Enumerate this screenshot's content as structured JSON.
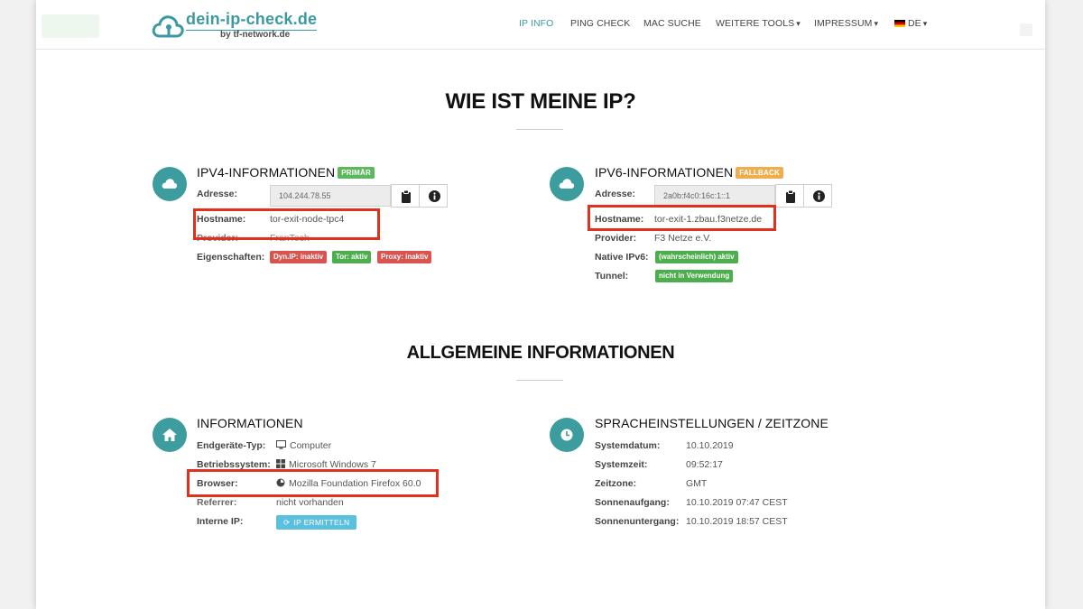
{
  "header": {
    "logo_title": "dein-ip-check.de",
    "logo_sub": "by tf-network.de",
    "nav": [
      {
        "label": "IP INFO",
        "active": true
      },
      {
        "label": "PING CHECK"
      },
      {
        "label": "MAC SUCHE"
      },
      {
        "label": "WEITERE TOOLS"
      },
      {
        "label": "IMPRESSUM"
      },
      {
        "label": "DE"
      }
    ]
  },
  "main_title": "WIE IST MEINE IP?",
  "ipv4": {
    "title": "IPV4-INFORMATIONEN",
    "badge": "PRIMÄR",
    "address_label": "Adresse:",
    "address_value": "104.244.78.55",
    "hostname_label": "Hostname:",
    "hostname_value": "tor-exit-node-tpc4",
    "provider_label": "Provider:",
    "provider_value": "FranTech",
    "props_label": "Eigenschaften:",
    "tags": [
      "Dyn.IP: inaktiv",
      "Tor: aktiv",
      "Proxy: inaktiv"
    ]
  },
  "ipv6": {
    "title": "IPV6-INFORMATIONEN",
    "badge": "FALLBACK",
    "address_label": "Adresse:",
    "address_value": "2a0b:f4c0:16c:1::1",
    "hostname_label": "Hostname:",
    "hostname_value": "tor-exit-1.zbau.f3netze.de",
    "provider_label": "Provider:",
    "provider_value": "F3 Netze e.V.",
    "native_label": "Native IPv6:",
    "native_value": "(wahrscheinlich) aktiv",
    "tunnel_label": "Tunnel:",
    "tunnel_value": "nicht in Verwendung"
  },
  "general_title": "ALLGEMEINE INFORMATIONEN",
  "info": {
    "title": "INFORMATIONEN",
    "device_label": "Endgeräte-Typ:",
    "device_value": "Computer",
    "os_label": "Betriebssystem:",
    "os_value": "Microsoft Windows 7",
    "browser_label": "Browser:",
    "browser_value": "Mozilla Foundation Firefox 60.0",
    "referrer_label": "Referrer:",
    "referrer_value": "nicht vorhanden",
    "internal_ip_label": "Interne IP:",
    "internal_ip_button": "IP ERMITTELN"
  },
  "locale": {
    "title": "SPRACHEINSTELLUNGEN / ZEITZONE",
    "date_label": "Systemdatum:",
    "date_value": "10.10.2019",
    "time_label": "Systemzeit:",
    "time_value": "09:52:17",
    "tz_label": "Zeitzone:",
    "tz_value": "GMT",
    "sunrise_label": "Sonnenaufgang:",
    "sunrise_value": "10.10.2019 07:47 CEST",
    "sunset_label": "Sonnenuntergang:",
    "sunset_value": "10.10.2019 18:57 CEST"
  },
  "colors": {
    "accent": "#3a9aa0",
    "highlight": "#e0301e",
    "badge_primary": "#5cb85c",
    "badge_fallback": "#f0ad4e",
    "tag_red": "#d9534f",
    "tag_green": "#4cae4c",
    "button_info": "#5bc0de"
  }
}
